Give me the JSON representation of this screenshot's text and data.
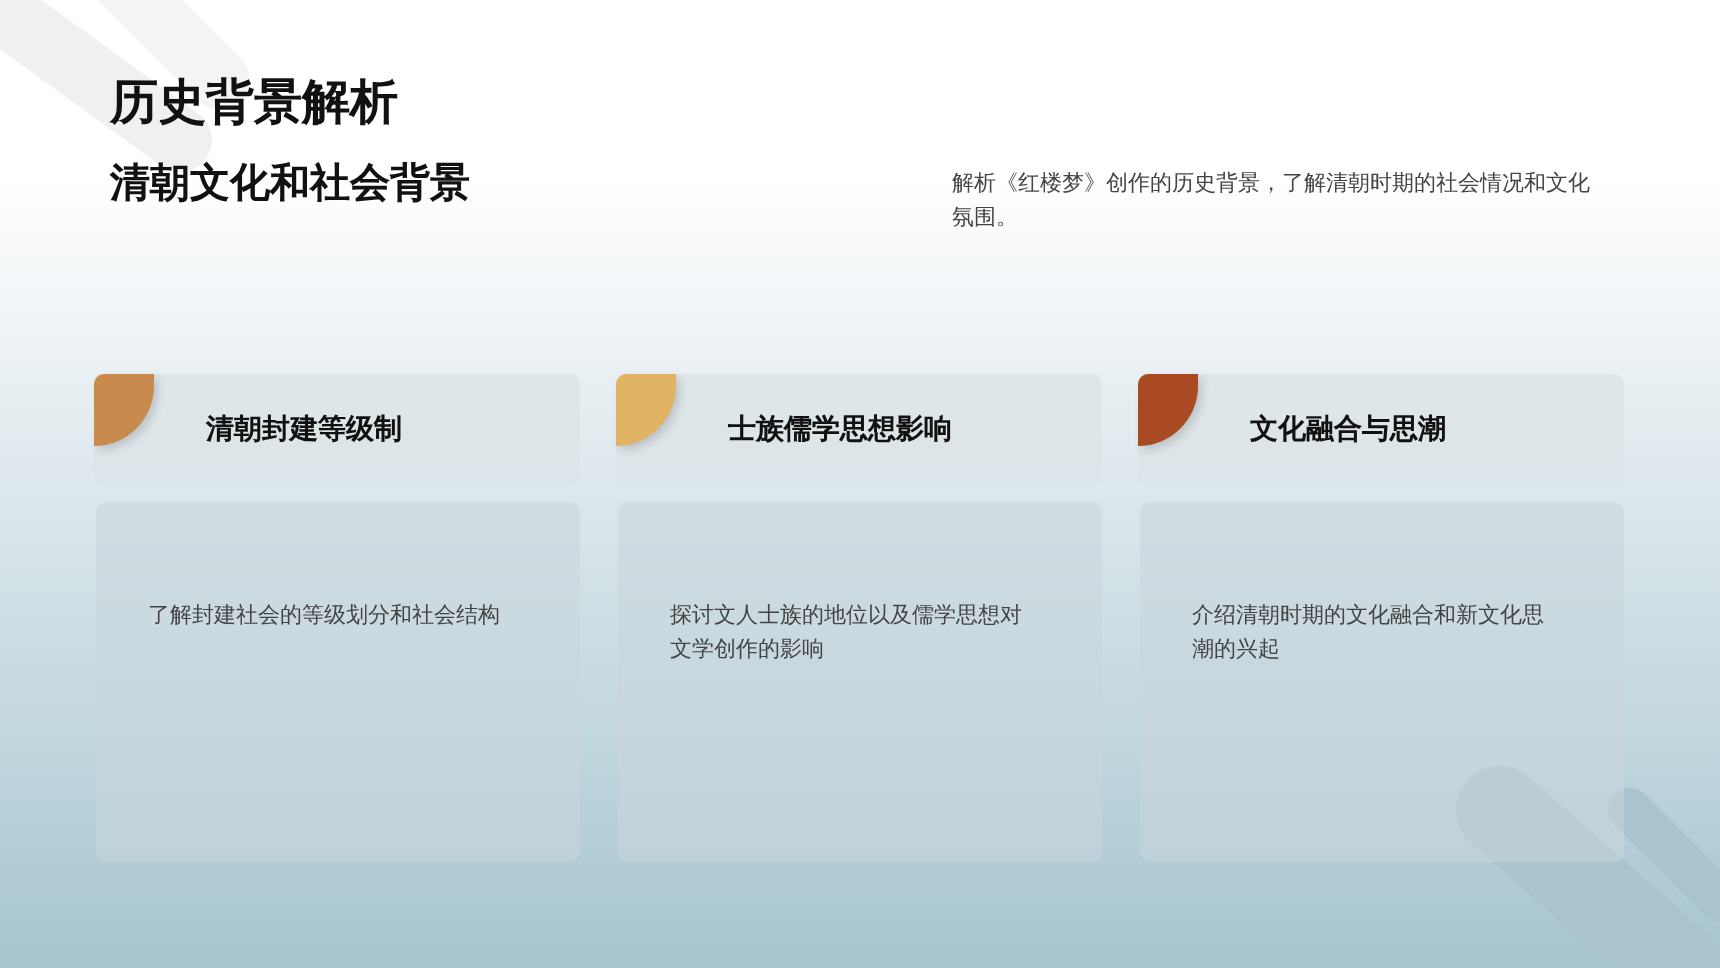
{
  "title": "历史背景解析",
  "subtitle": "清朝文化和社会背景",
  "description": "解析《红楼梦》创作的历史背景，了解清朝时期的社会情况和文化氛围。",
  "cards": [
    {
      "heading": "清朝封建等级制",
      "body": "了解封建社会的等级划分和社会结构",
      "color": "#c98a4e"
    },
    {
      "heading": "士族儒学思想影响",
      "body": "探讨文人士族的地位以及儒学思想对文学创作的影响",
      "color": "#e2b363"
    },
    {
      "heading": "文化融合与思潮",
      "body": "介绍清朝时期的文化融合和新文化思潮的兴起",
      "color": "#a94a22"
    }
  ]
}
